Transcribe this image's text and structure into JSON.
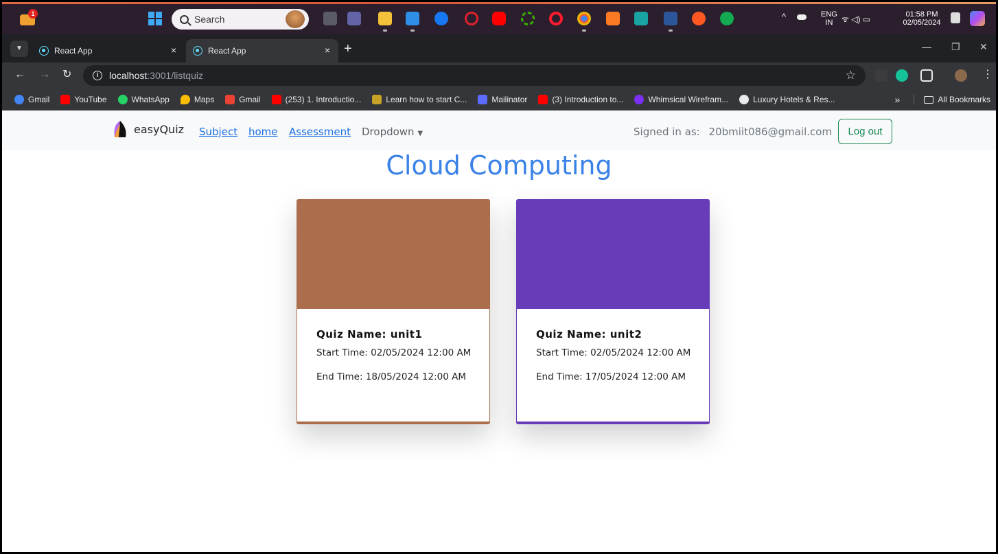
{
  "taskbar": {
    "notification_badge": "1",
    "search_placeholder": "Search",
    "language_top": "ENG",
    "language_bottom": "IN",
    "time": "01:58 PM",
    "date": "02/05/2024"
  },
  "browser": {
    "tabs": [
      {
        "title": "React App",
        "close": "×"
      },
      {
        "title": "React App",
        "close": "×"
      }
    ],
    "new_tab": "+",
    "url_host": "localhost",
    "url_path": ":3001/listquiz",
    "bookmarks": [
      {
        "label": "Gmail",
        "icon": "google-icon",
        "color": "#4285f4"
      },
      {
        "label": "YouTube",
        "icon": "youtube-icon",
        "color": "#ff0000"
      },
      {
        "label": "WhatsApp",
        "icon": "whatsapp-icon",
        "color": "#25d366"
      },
      {
        "label": "Maps",
        "icon": "maps-icon",
        "color": "#fbbc04"
      },
      {
        "label": "Gmail",
        "icon": "gmail-icon",
        "color": "#ea4335"
      },
      {
        "label": "(253) 1. Introductio...",
        "icon": "youtube-icon",
        "color": "#ff0000"
      },
      {
        "label": "Learn how to start C...",
        "icon": "cc-icon",
        "color": "#c9a227"
      },
      {
        "label": "Mailinator",
        "icon": "mailinator-icon",
        "color": "#5b6cff"
      },
      {
        "label": "(3) Introduction to...",
        "icon": "youtube-icon",
        "color": "#ff0000"
      },
      {
        "label": "Whimsical Wirefram...",
        "icon": "whimsical-icon",
        "color": "#7b2ff7"
      },
      {
        "label": "Luxury Hotels & Res...",
        "icon": "globe-icon",
        "color": "#e8eaed"
      }
    ],
    "bookmarks_overflow": "»",
    "all_bookmarks": "All Bookmarks"
  },
  "navbar": {
    "brand": "easyQuiz",
    "links": [
      "Subject",
      "home",
      "Assessment"
    ],
    "dropdown": "Dropdown",
    "signed_in_label": "Signed in as:",
    "user_email": "20bmiit086@gmail.com",
    "logout_label": "Log out"
  },
  "page": {
    "title": "Cloud Computing"
  },
  "quizzes": [
    {
      "name": "Quiz Name: unit1",
      "start": "Start Time: 02/05/2024 12:00 AM",
      "end": "End Time: 18/05/2024 12:00 AM",
      "color": "#ab6d4b"
    },
    {
      "name": "Quiz Name: unit2",
      "start": "Start Time: 02/05/2024 12:00 AM",
      "end": "End Time: 17/05/2024 12:00 AM",
      "color": "#683cb9"
    }
  ]
}
